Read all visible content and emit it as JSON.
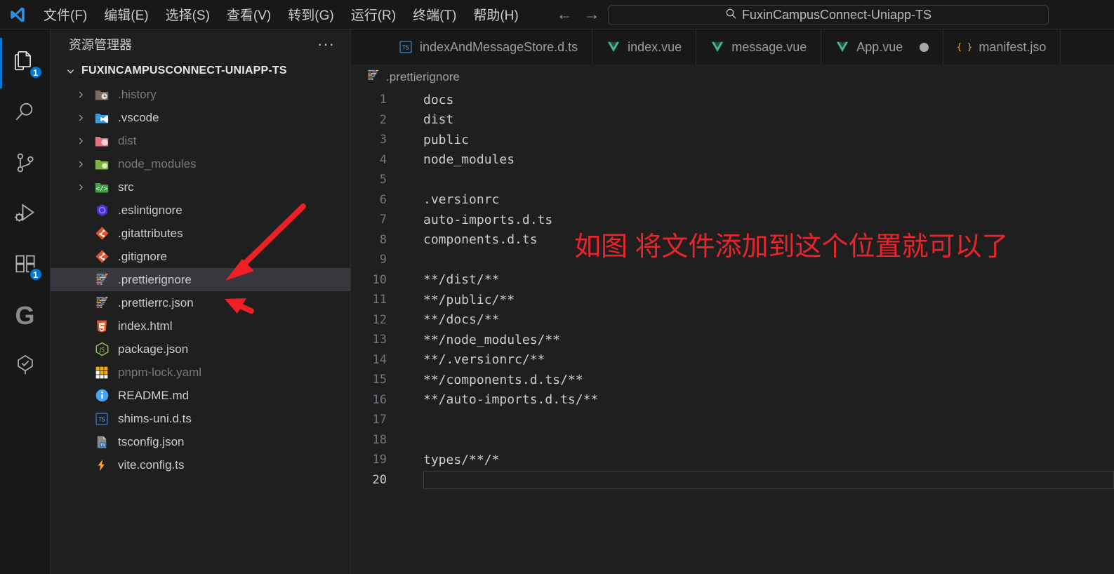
{
  "titlebar": {
    "logo_icon": "vscode-logo-icon",
    "menus": [
      {
        "label": "文件(F)",
        "name": "menu-file"
      },
      {
        "label": "编辑(E)",
        "name": "menu-edit"
      },
      {
        "label": "选择(S)",
        "name": "menu-selection"
      },
      {
        "label": "查看(V)",
        "name": "menu-view"
      },
      {
        "label": "转到(G)",
        "name": "menu-go"
      },
      {
        "label": "运行(R)",
        "name": "menu-run"
      },
      {
        "label": "终端(T)",
        "name": "menu-terminal"
      },
      {
        "label": "帮助(H)",
        "name": "menu-help"
      }
    ],
    "nav_back": "←",
    "nav_forward": "→",
    "search": {
      "icon": "search-icon",
      "value": "FuxinCampusConnect-Uniapp-TS"
    }
  },
  "activitybar": {
    "items": [
      {
        "name": "explorer",
        "icon": "files-icon",
        "badge": "1",
        "active": true
      },
      {
        "name": "search",
        "icon": "search-icon",
        "badge": "",
        "active": false
      },
      {
        "name": "source-control",
        "icon": "source-control-icon",
        "badge": "",
        "active": false
      },
      {
        "name": "run-debug",
        "icon": "run-debug-icon",
        "badge": "",
        "active": false
      },
      {
        "name": "extensions",
        "icon": "extensions-icon",
        "badge": "1",
        "active": false
      },
      {
        "name": "gitlens",
        "icon": "gitlens-g-icon",
        "badge": "",
        "active": false
      },
      {
        "name": "todo-tree",
        "icon": "tree-check-icon",
        "badge": "",
        "active": false
      }
    ]
  },
  "sidebar": {
    "header_title": "资源管理器",
    "header_more_icon": "more-actions-icon",
    "root": {
      "label": "FUXINCAMPUSCONNECT-UNIAPP-TS",
      "expanded": true,
      "chevron_icon": "chevron-down-icon"
    },
    "items": [
      {
        "label": ".history",
        "type": "folder",
        "icon": "folder-history-icon",
        "dim": true,
        "chevron": true,
        "selected": false
      },
      {
        "label": ".vscode",
        "type": "folder",
        "icon": "folder-vscode-icon",
        "dim": false,
        "chevron": true,
        "selected": false
      },
      {
        "label": "dist",
        "type": "folder",
        "icon": "folder-dist-icon",
        "dim": true,
        "chevron": true,
        "selected": false
      },
      {
        "label": "node_modules",
        "type": "folder",
        "icon": "folder-node-icon",
        "dim": true,
        "chevron": true,
        "selected": false
      },
      {
        "label": "src",
        "type": "folder",
        "icon": "folder-src-icon",
        "dim": false,
        "chevron": true,
        "selected": false
      },
      {
        "label": ".eslintignore",
        "type": "file",
        "icon": "eslint-icon",
        "dim": false,
        "chevron": false,
        "selected": false
      },
      {
        "label": ".gitattributes",
        "type": "file",
        "icon": "git-icon",
        "dim": false,
        "chevron": false,
        "selected": false
      },
      {
        "label": ".gitignore",
        "type": "file",
        "icon": "git-icon",
        "dim": false,
        "chevron": false,
        "selected": false
      },
      {
        "label": ".prettierignore",
        "type": "file",
        "icon": "prettier-icon",
        "dim": false,
        "chevron": false,
        "selected": true
      },
      {
        "label": ".prettierrc.json",
        "type": "file",
        "icon": "prettier-icon",
        "dim": false,
        "chevron": false,
        "selected": false
      },
      {
        "label": "index.html",
        "type": "file",
        "icon": "html5-icon",
        "dim": false,
        "chevron": false,
        "selected": false
      },
      {
        "label": "package.json",
        "type": "file",
        "icon": "nodejs-icon",
        "dim": false,
        "chevron": false,
        "selected": false
      },
      {
        "label": "pnpm-lock.yaml",
        "type": "file",
        "icon": "pnpm-lock-icon",
        "dim": true,
        "chevron": false,
        "selected": false
      },
      {
        "label": "README.md",
        "type": "file",
        "icon": "readme-info-icon",
        "dim": false,
        "chevron": false,
        "selected": false
      },
      {
        "label": "shims-uni.d.ts",
        "type": "file",
        "icon": "typescript-def-icon",
        "dim": false,
        "chevron": false,
        "selected": false
      },
      {
        "label": "tsconfig.json",
        "type": "file",
        "icon": "tsconfig-icon",
        "dim": false,
        "chevron": false,
        "selected": false
      },
      {
        "label": "vite.config.ts",
        "type": "file",
        "icon": "vite-icon",
        "dim": false,
        "chevron": false,
        "selected": false
      }
    ]
  },
  "editor": {
    "tabs": [
      {
        "label": "indexAndMessageStore.d.ts",
        "icon": "typescript-def-icon",
        "dirty": false,
        "active": false
      },
      {
        "label": "index.vue",
        "icon": "vue-icon",
        "dirty": false,
        "active": false
      },
      {
        "label": "message.vue",
        "icon": "vue-icon",
        "dirty": false,
        "active": false
      },
      {
        "label": "App.vue",
        "icon": "vue-icon",
        "dirty": true,
        "active": false
      },
      {
        "label": "manifest.jso",
        "icon": "json-icon",
        "dirty": false,
        "active": false
      }
    ],
    "breadcrumb": {
      "icon": "prettier-icon",
      "label": ".prettierignore"
    },
    "lines": [
      {
        "n": "1",
        "text": "docs"
      },
      {
        "n": "2",
        "text": "dist"
      },
      {
        "n": "3",
        "text": "public"
      },
      {
        "n": "4",
        "text": "node_modules"
      },
      {
        "n": "5",
        "text": ""
      },
      {
        "n": "6",
        "text": ".versionrc"
      },
      {
        "n": "7",
        "text": "auto-imports.d.ts"
      },
      {
        "n": "8",
        "text": "components.d.ts"
      },
      {
        "n": "9",
        "text": ""
      },
      {
        "n": "10",
        "text": "**/dist/**"
      },
      {
        "n": "11",
        "text": "**/public/**"
      },
      {
        "n": "12",
        "text": "**/docs/**"
      },
      {
        "n": "13",
        "text": "**/node_modules/**"
      },
      {
        "n": "14",
        "text": "**/.versionrc/**"
      },
      {
        "n": "15",
        "text": "**/components.d.ts/**"
      },
      {
        "n": "16",
        "text": "**/auto-imports.d.ts/**"
      },
      {
        "n": "17",
        "text": ""
      },
      {
        "n": "18",
        "text": ""
      },
      {
        "n": "19",
        "text": "types/**/*"
      },
      {
        "n": "20",
        "text": "",
        "active": true
      }
    ]
  },
  "annotation": {
    "text": "如图 将文件添加到这个位置就可以了",
    "color": "#e8252a",
    "arrow_large": "red-arrow-pointing-to-prettierignore",
    "arrow_small": "red-arrow-pointing-to-prettierrc"
  }
}
